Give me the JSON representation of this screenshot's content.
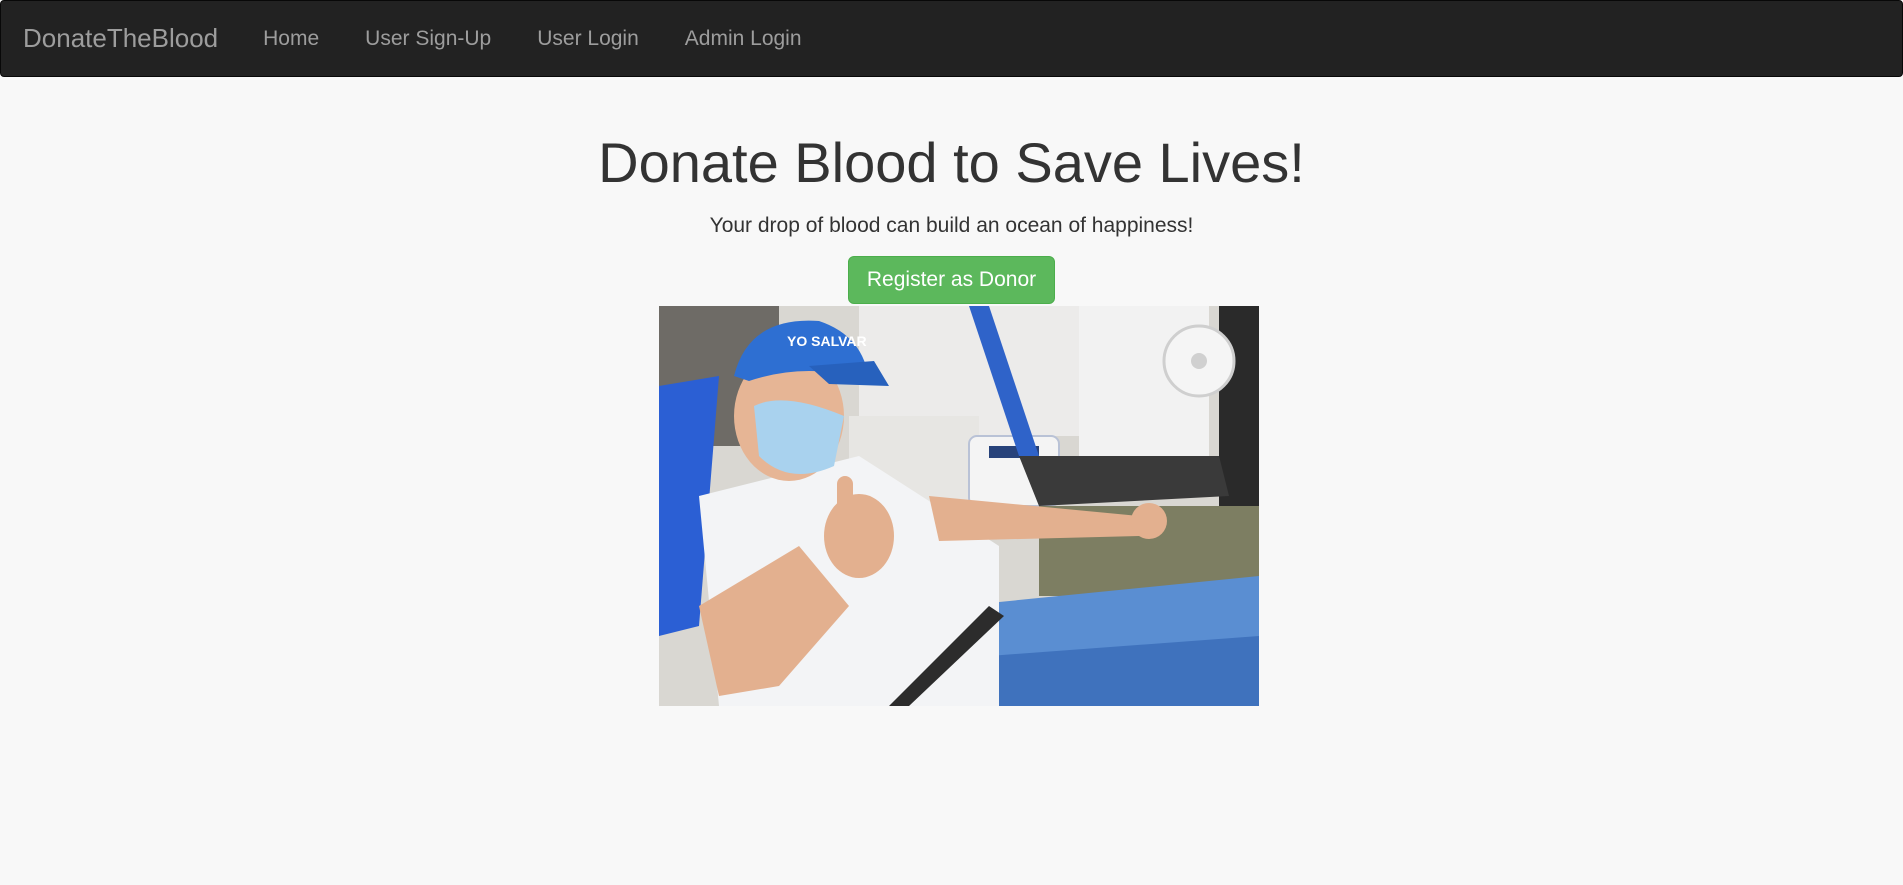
{
  "navbar": {
    "brand": "DonateTheBlood",
    "items": [
      {
        "label": "Home"
      },
      {
        "label": "User Sign-Up"
      },
      {
        "label": "User Login"
      },
      {
        "label": "Admin Login"
      }
    ]
  },
  "hero": {
    "title": "Donate Blood to Save Lives!",
    "subtitle": "Your drop of blood can build an ocean of happiness!",
    "cta_label": "Register as Donor",
    "image_cap_text": "YO SALVAR"
  },
  "colors": {
    "navbar_bg": "#222222",
    "nav_text": "#9d9d9d",
    "cta_bg": "#5cb85c",
    "page_bg": "#f8f8f8"
  }
}
